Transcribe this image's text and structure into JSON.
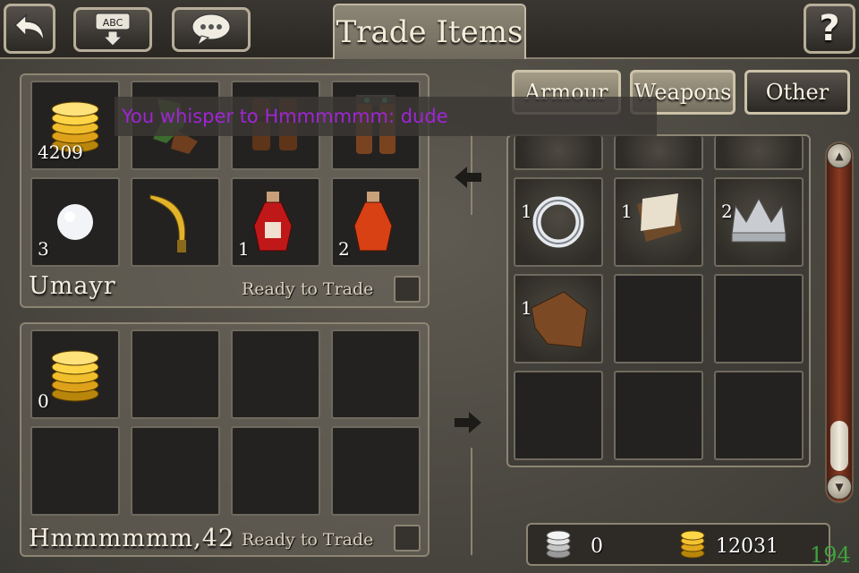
{
  "header": {
    "title": "Trade Items",
    "back_icon": "back-arrow-icon",
    "keyboard_icon": "keyboard-abc-icon",
    "keyboard_label": "ABC",
    "chat_icon": "chat-bubble-icon",
    "help_label": "?"
  },
  "chat": {
    "whisper": "You whisper to Hmmmmmm: dude"
  },
  "my_offer": {
    "player_name": "Umayr",
    "ready_label": "Ready to Trade",
    "slots": [
      {
        "item": "gold-coins-icon",
        "qty": "4209"
      },
      {
        "item": "green-boots-icon",
        "qty": ""
      },
      {
        "item": "leather-greaves-icon",
        "qty": ""
      },
      {
        "item": "studded-leggings-icon",
        "qty": ""
      },
      {
        "item": "snowball-icon",
        "qty": "3"
      },
      {
        "item": "scimitar-icon",
        "qty": ""
      },
      {
        "item": "red-potion-icon",
        "qty": "1"
      },
      {
        "item": "orange-potion-icon",
        "qty": "2"
      }
    ]
  },
  "their_offer": {
    "player_name": "Hmmmmmm,42",
    "ready_label": "Ready to Trade",
    "slots": [
      {
        "item": "gold-coins-icon",
        "qty": "0"
      }
    ]
  },
  "inventory": {
    "tabs": [
      "Armour",
      "Weapons",
      "Other"
    ],
    "active_tab": "Other",
    "rows": [
      {
        "item": "ring-icon",
        "qty": "1"
      },
      {
        "item": "cloth-scrap-icon",
        "qty": "1"
      },
      {
        "item": "silver-crown-icon",
        "qty": "2"
      },
      {
        "item": "leather-hide-icon",
        "qty": "1"
      }
    ],
    "silver": "0",
    "gold": "12031"
  },
  "fps": "194",
  "colors": {
    "whisper_text": "#a025d4",
    "fps_text": "#3ea33a"
  }
}
